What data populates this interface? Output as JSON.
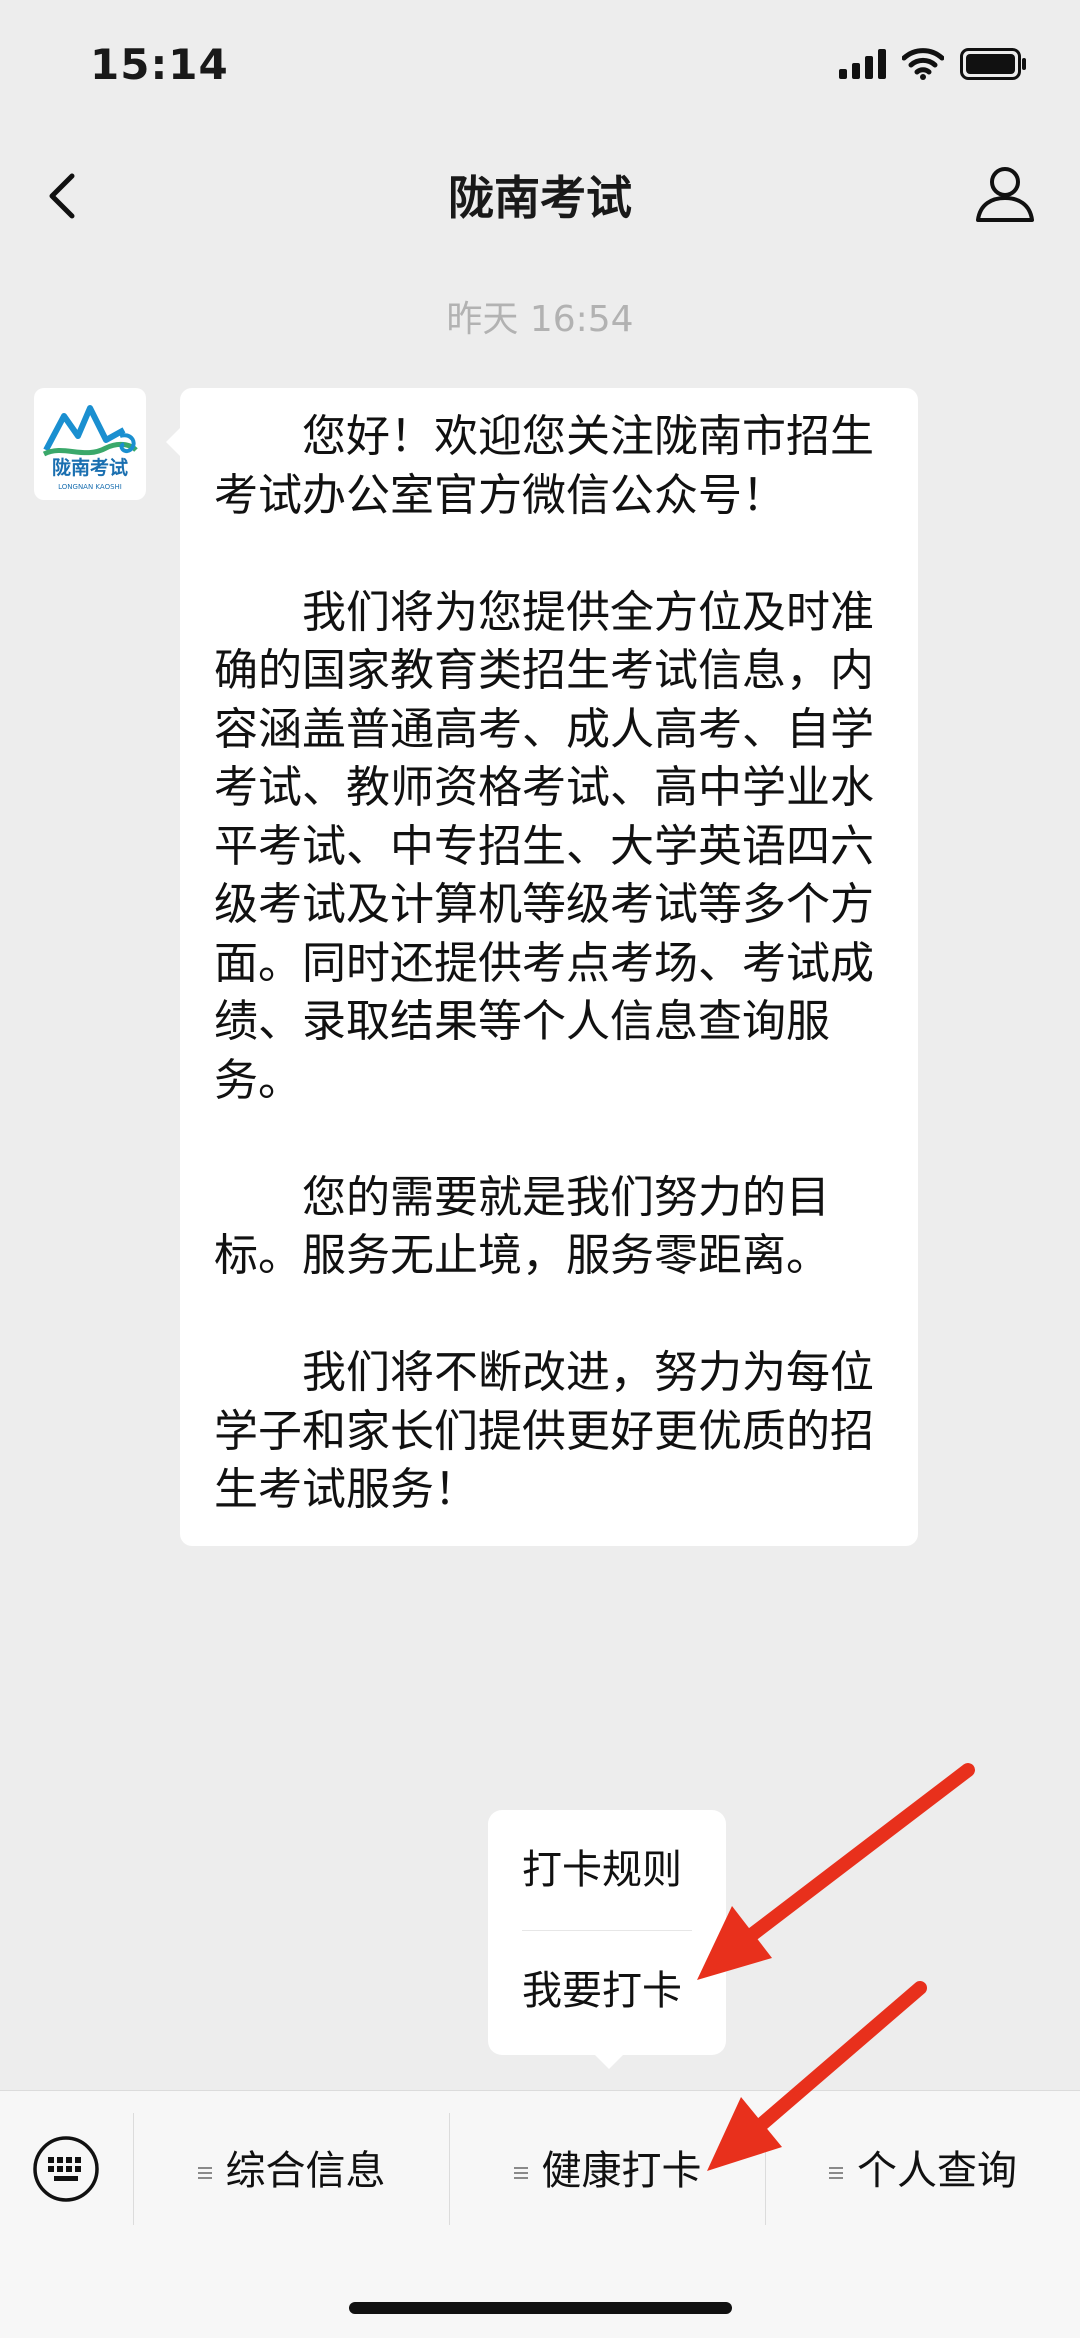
{
  "status_bar": {
    "time": "15:14"
  },
  "nav": {
    "title": "陇南考试"
  },
  "timestamp": "昨天 16:54",
  "avatar": {
    "logo_text": "陇南考试",
    "logo_subtext": "LONGNAN KAOSHI"
  },
  "message": {
    "paragraphs": [
      "您好！欢迎您关注陇南市招生考试办公室官方微信公众号！",
      "我们将为您提供全方位及时准确的国家教育类招生考试信息，内容涵盖普通高考、成人高考、自学考试、教师资格考试、高中学业水平考试、中专招生、大学英语四六级考试及计算机等级考试等多个方面。同时还提供考点考场、考试成绩、录取结果等个人信息查询服务。",
      "您的需要就是我们努力的目标。服务无止境，服务零距离。",
      "我们将不断改进，努力为每位学子和家长们提供更好更优质的招生考试服务！"
    ]
  },
  "popup": {
    "items": [
      "打卡规则",
      "我要打卡"
    ]
  },
  "menu_bar": {
    "items": [
      "综合信息",
      "健康打卡",
      "个人查询"
    ]
  },
  "annotation": {
    "arrow_color": "#e8301c"
  }
}
